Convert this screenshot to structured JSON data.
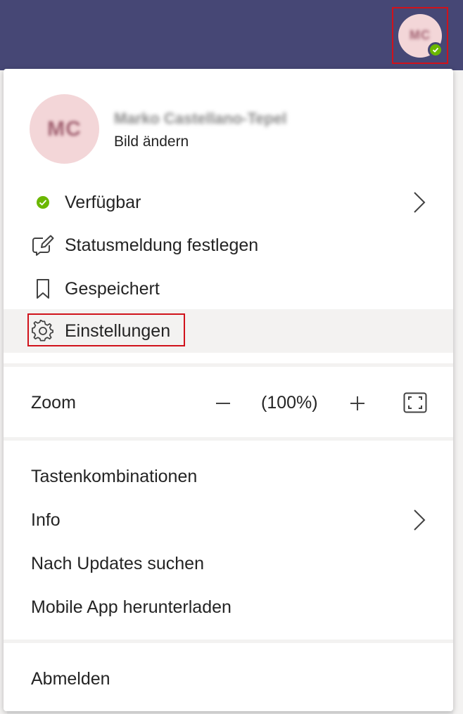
{
  "header": {
    "avatar_initials": "MC",
    "presence_color": "#6bb700",
    "bar_color": "#464775"
  },
  "profile": {
    "initials": "MC",
    "name": "Marko Castellano-Tepel",
    "change_picture": "Bild ändern"
  },
  "status_items": [
    {
      "label": "Verfügbar",
      "icon": "available-dot-icon"
    },
    {
      "label": "Statusmeldung festlegen",
      "icon": "edit-note-icon"
    },
    {
      "label": "Gespeichert",
      "icon": "bookmark-icon"
    },
    {
      "label": "Einstellungen",
      "icon": "gear-icon"
    }
  ],
  "zoom": {
    "label": "Zoom",
    "value": "(100%)",
    "minus": "−",
    "plus": "+"
  },
  "secondary_items": [
    {
      "label": "Tastenkombinationen"
    },
    {
      "label": "Info"
    },
    {
      "label": "Nach Updates suchen"
    },
    {
      "label": "Mobile App herunterladen"
    }
  ],
  "signout": {
    "label": "Abmelden"
  }
}
